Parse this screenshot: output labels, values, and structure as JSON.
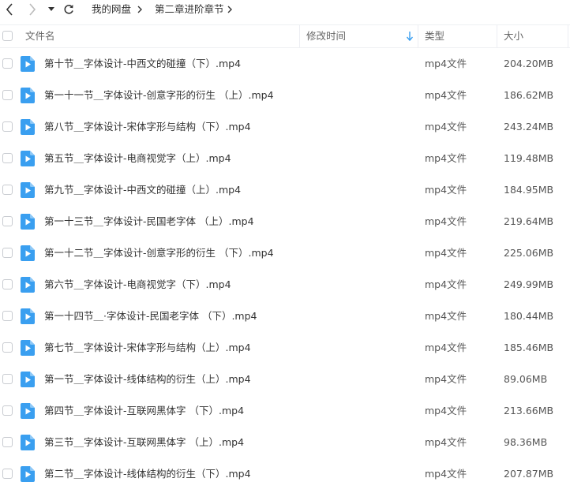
{
  "breadcrumb": {
    "items": [
      "我的网盘",
      "第二章进阶章节"
    ]
  },
  "header": {
    "filename": "文件名",
    "modified": "修改时间",
    "type": "类型",
    "size": "大小"
  },
  "colors": {
    "accent": "#3a9ff0",
    "icon_blue": "#3a9ff0",
    "text": "#333333",
    "muted": "#666666"
  },
  "files": [
    {
      "name": "第十节＿字体设计-中西文的碰撞（下）.mp4",
      "type": "mp4文件",
      "size": "204.20MB"
    },
    {
      "name": "第一十一节＿字体设计-创意字形的衍生 （上）.mp4",
      "type": "mp4文件",
      "size": "186.62MB"
    },
    {
      "name": "第八节＿字体设计-宋体字形与结构（下）.mp4",
      "type": "mp4文件",
      "size": "243.24MB"
    },
    {
      "name": "第五节＿字体设计-电商视觉字（上）.mp4",
      "type": "mp4文件",
      "size": "119.48MB"
    },
    {
      "name": "第九节＿字体设计-中西文的碰撞（上）.mp4",
      "type": "mp4文件",
      "size": "184.95MB"
    },
    {
      "name": "第一十三节＿字体设计-民国老字体 （上）.mp4",
      "type": "mp4文件",
      "size": "219.64MB"
    },
    {
      "name": "第一十二节＿字体设计-创意字形的衍生 （下）.mp4",
      "type": "mp4文件",
      "size": "225.06MB"
    },
    {
      "name": "第六节＿字体设计-电商视觉字（下）.mp4",
      "type": "mp4文件",
      "size": "249.99MB"
    },
    {
      "name": "第一十四节＿·字体设计-民国老字体 （下）.mp4",
      "type": "mp4文件",
      "size": "180.44MB"
    },
    {
      "name": "第七节＿字体设计-宋体字形与结构（上）.mp4",
      "type": "mp4文件",
      "size": "185.46MB"
    },
    {
      "name": "第一节＿字体设计-线体结构的衍生（上）.mp4",
      "type": "mp4文件",
      "size": "89.06MB"
    },
    {
      "name": "第四节＿字体设计-互联网黑体字 （下）.mp4",
      "type": "mp4文件",
      "size": "213.66MB"
    },
    {
      "name": "第三节＿字体设计-互联网黑体字 （上）.mp4",
      "type": "mp4文件",
      "size": "98.36MB"
    },
    {
      "name": "第二节＿字体设计-线体结构的衍生（下）.mp4",
      "type": "mp4文件",
      "size": "207.87MB"
    }
  ]
}
